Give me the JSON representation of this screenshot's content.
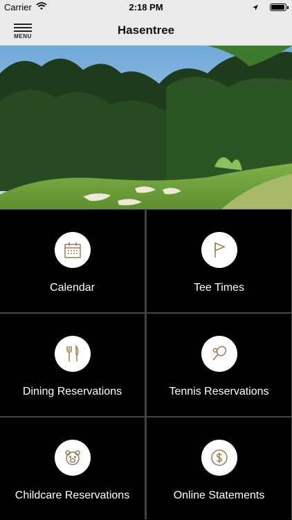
{
  "status_bar": {
    "carrier": "Carrier",
    "time": "2:18 PM"
  },
  "nav": {
    "menu_label": "MENU",
    "title": "Hasentree"
  },
  "tiles": [
    {
      "label": "Calendar",
      "icon": "calendar-icon"
    },
    {
      "label": "Tee Times",
      "icon": "flag-icon"
    },
    {
      "label": "Dining Reservations",
      "icon": "fork-knife-icon"
    },
    {
      "label": "Tennis Reservations",
      "icon": "tennis-racket-icon"
    },
    {
      "label": "Childcare Reservations",
      "icon": "teddy-bear-icon"
    },
    {
      "label": "Online Statements",
      "icon": "dollar-icon"
    }
  ],
  "colors": {
    "icon": "#9a7b4f",
    "tile_bg": "#000000",
    "bar_bg": "#eaeaea"
  }
}
